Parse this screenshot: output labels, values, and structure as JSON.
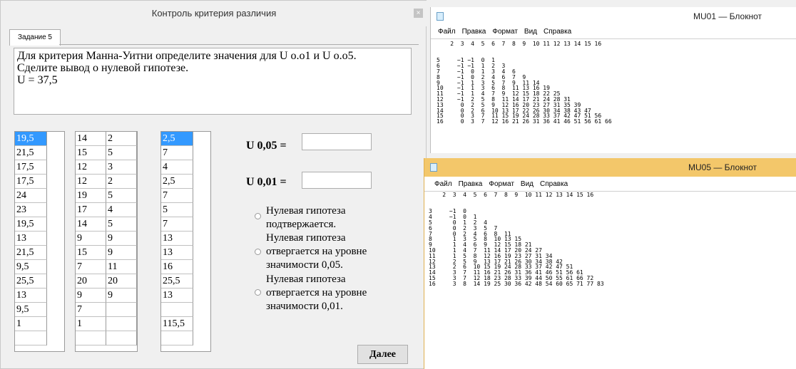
{
  "dialog": {
    "title": "Контроль критерия различия",
    "close_label": "×",
    "tab_label": "Задание 5",
    "question_lines": [
      "Для критерия Манна-Уитни определите значения для U o.o1 и U o.o5.",
      "Сделите вывод о нулевой гипотезе.",
      "U = 37,5"
    ],
    "list1": [
      "19,5",
      "21,5",
      "17,5",
      "17,5",
      "24",
      "23",
      "19,5",
      "13",
      "21,5",
      "9,5",
      "25,5",
      "13",
      "9,5",
      "1"
    ],
    "list2_col1": [
      "14",
      "15",
      "12",
      "12",
      "19",
      "17",
      "14",
      "9",
      "15",
      "7",
      "20",
      "9",
      "7",
      "1"
    ],
    "list2_col2": [
      "2",
      "5",
      "3",
      "2",
      "5",
      "4",
      "5",
      "9",
      "9",
      "11",
      "20",
      "9"
    ],
    "list3": [
      "2,5",
      "7",
      "4",
      "2,5",
      "7",
      "5",
      "7",
      "13",
      "13",
      "16",
      "25,5",
      "13",
      "",
      "115,5"
    ],
    "u005_label": "U 0,05 =",
    "u001_label": "U 0,01 =",
    "u005_value": "",
    "u001_value": "",
    "radio_options": [
      [
        "Нулевая гипотеза",
        "подтвержается."
      ],
      [
        "Нулевая гипотеза",
        "отвергается на уровне",
        "значимости 0,05."
      ],
      [
        "Нулевая гипотеза",
        "отвергается на уровне",
        "значимости 0,01."
      ]
    ],
    "next_label": "Далее"
  },
  "notepad1": {
    "title": "MU01 — Блокнот",
    "menu": [
      "Файл",
      "Правка",
      "Формат",
      "Вид",
      "Справка"
    ],
    "content": "    2  3  4  5  6  7  8  9  10 11 12 13 14 15 16\n\n\n5     −1 −1  0  1\n6     −1 −1  1  2  3\n7     −1  0  1  3  4  6\n8     −1  0  2  4  6  7  9\n9     −1  1  3  5  7  9  11 14\n10    −1  1  3  6  8  11 13 16 19\n11    −1  1  4  7  9  12 15 18 22 25\n12    −1  2  5  8  11 14 17 21 24 28 31\n13     0  2  5  9  12 16 20 23 27 31 35 39\n14     0  2  6  10 13 17 22 26 30 34 38 43 47\n15     0  3  7  11 15 19 24 28 33 37 42 47 51 56\n16     0  3  7  12 16 21 26 31 36 41 46 51 56 61 66"
  },
  "notepad2": {
    "title": "MU05 — Блокнот",
    "menu": [
      "Файл",
      "Правка",
      "Формат",
      "Вид",
      "Справка"
    ],
    "content": "    2  3  4  5  6  7  8  9  10 11 12 13 14 15 16\n\n\n3     −1  0\n4     −1  0  1\n5      0  1  2  4\n6      0  2  3  5  7\n7      0  2  4  6  8  11\n8      1  3  5  8  10 13 15\n9      1  4  6  9  12 15 18 21\n10     1  4  7  11 14 17 20 24 27\n11     1  5  8  12 16 19 23 27 31 34\n12     2  5  9  13 17 21 26 30 34 38 42\n13     2  6  10 15 19 24 28 33 37 42 47 51\n14     3  7  11 16 21 26 31 36 41 46 51 56 61\n15     3  7  12 18 23 28 33 39 44 50 55 61 66 72\n16     3  8  14 19 25 30 36 42 48 54 60 65 71 77 83"
  },
  "colors": {
    "selection": "#3399ff",
    "notepad2_titlebar": "#f3c76a"
  }
}
